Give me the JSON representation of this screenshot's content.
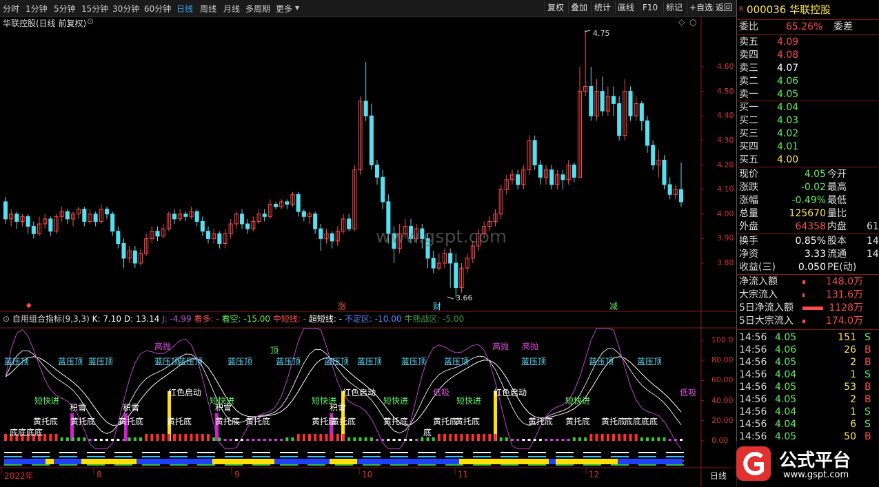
{
  "toolbar": {
    "periods": [
      "分时",
      "1分钟",
      "5分钟",
      "15分钟",
      "30分钟",
      "60分钟",
      "日线",
      "周线",
      "月线",
      "多周期",
      "更多"
    ],
    "active": "日线",
    "right_buttons": [
      "复权",
      "叠加",
      "统计",
      "画线",
      "F10",
      "标记",
      "+自选",
      "返回"
    ]
  },
  "chart": {
    "title": "华联控股(日线 前复权)",
    "price_ticks": [
      "4.60",
      "4.50",
      "4.40",
      "4.30",
      "4.20",
      "4.10",
      "4.00",
      "3.90",
      "3.80"
    ],
    "high_label": "4.75",
    "low_label": "3.66",
    "watermark": "www.gspt.com",
    "event_markers": [
      "涨",
      "财",
      "减"
    ],
    "indicator_header": {
      "name": "自用组合指标(9,3,3)",
      "k": "K: 7.10",
      "d": "D: 13.14",
      "j": "J: -4.99",
      "kanduo": "看多: -",
      "kankong": "看空: -15.00",
      "zhongduan": "中短线: -",
      "chaoduan": "超短线: -",
      "buding": "不定区: -10.00",
      "niuxiong": "牛熊战区: -5.00"
    },
    "ind_ticks": [
      "100.0",
      "80.00",
      "60.00",
      "40.00",
      "20.00",
      "0.00"
    ],
    "dates": [
      "2022年",
      "8",
      "9",
      "10",
      "11",
      "12"
    ],
    "period_label": "日线",
    "annotations": [
      {
        "t": "蓝压顶",
        "c": "cyan"
      },
      {
        "t": "蓝压顶",
        "c": "cyan"
      },
      {
        "t": "蓝压顶",
        "c": "cyan"
      },
      {
        "t": "蓝压顶",
        "c": "cyan"
      },
      {
        "t": "蓝压顶",
        "c": "cyan"
      },
      {
        "t": "蓝压顶",
        "c": "cyan"
      },
      {
        "t": "蓝压顶",
        "c": "cyan"
      },
      {
        "t": "蓝压顶",
        "c": "cyan"
      },
      {
        "t": "蓝压顶",
        "c": "cyan"
      },
      {
        "t": "蓝压顶",
        "c": "cyan"
      },
      {
        "t": "蓝压顶",
        "c": "cyan"
      },
      {
        "t": "蓝压顶",
        "c": "cyan"
      },
      {
        "t": "蓝压顶",
        "c": "cyan"
      },
      {
        "t": "蓝压顶",
        "c": "cyan"
      },
      {
        "t": "高抛",
        "c": "magenta"
      },
      {
        "t": "高抛",
        "c": "magenta"
      },
      {
        "t": "高抛",
        "c": "magenta"
      },
      {
        "t": "顶",
        "c": "green"
      },
      {
        "t": "短快进",
        "c": "green"
      },
      {
        "t": "短快进",
        "c": "green"
      },
      {
        "t": "短快进",
        "c": "green"
      },
      {
        "t": "短快进",
        "c": "green"
      },
      {
        "t": "短快进",
        "c": "green"
      },
      {
        "t": "短快进",
        "c": "green"
      },
      {
        "t": "积雪",
        "c": "white"
      },
      {
        "t": "积雪",
        "c": "white"
      },
      {
        "t": "积雪",
        "c": "white"
      },
      {
        "t": "积雪",
        "c": "white"
      },
      {
        "t": "红色启动",
        "c": "white"
      },
      {
        "t": "红色启动",
        "c": "white"
      },
      {
        "t": "红色启动",
        "c": "white"
      },
      {
        "t": "低吸",
        "c": "magenta"
      },
      {
        "t": "低吸",
        "c": "magenta"
      },
      {
        "t": "黄托底",
        "c": "white"
      },
      {
        "t": "黄托底",
        "c": "white"
      },
      {
        "t": "黄托底",
        "c": "white"
      },
      {
        "t": "黄托底",
        "c": "white"
      },
      {
        "t": "黄托底",
        "c": "white"
      },
      {
        "t": "黄托底",
        "c": "white"
      },
      {
        "t": "黄托底",
        "c": "white"
      },
      {
        "t": "黄托底",
        "c": "white"
      },
      {
        "t": "黄托底",
        "c": "white"
      },
      {
        "t": "黄托底",
        "c": "white"
      },
      {
        "t": "黄托底",
        "c": "white"
      },
      {
        "t": "黄托底",
        "c": "white"
      },
      {
        "t": "黄托底",
        "c": "white"
      },
      {
        "t": "黄托底",
        "c": "white"
      },
      {
        "t": "底底底底",
        "c": "white"
      },
      {
        "t": "底底底底",
        "c": "white"
      },
      {
        "t": "底",
        "c": "white"
      }
    ]
  },
  "panel": {
    "code": "000036",
    "name": "华联控股",
    "weibi_label": "委比",
    "weibi": "65.26%",
    "weicha_label": "委差",
    "asks": [
      {
        "label": "卖五",
        "price": "4.09",
        "color": "red"
      },
      {
        "label": "卖四",
        "price": "4.08",
        "color": "red"
      },
      {
        "label": "卖三",
        "price": "4.07",
        "color": "white"
      },
      {
        "label": "卖二",
        "price": "4.06",
        "color": "green"
      },
      {
        "label": "卖一",
        "price": "4.05",
        "color": "green"
      }
    ],
    "bids": [
      {
        "label": "买一",
        "price": "4.04",
        "color": "green"
      },
      {
        "label": "买二",
        "price": "4.03",
        "color": "green"
      },
      {
        "label": "买三",
        "price": "4.02",
        "color": "green"
      },
      {
        "label": "买四",
        "price": "4.01",
        "color": "green"
      },
      {
        "label": "买五",
        "price": "4.00",
        "color": "yellow"
      }
    ],
    "stats": [
      {
        "l": "现价",
        "v": "4.05",
        "vc": "green",
        "r": "今开"
      },
      {
        "l": "涨跌",
        "v": "-0.02",
        "vc": "green",
        "r": "最高"
      },
      {
        "l": "涨幅",
        "v": "-0.49%",
        "vc": "green",
        "r": "最低"
      },
      {
        "l": "总量",
        "v": "125670",
        "vc": "yellow",
        "r": "量比"
      },
      {
        "l": "外盘",
        "v": "64358",
        "vc": "red",
        "r": "内盘",
        "r2": "61"
      }
    ],
    "stats2": [
      {
        "l": "换手",
        "v": "0.85%",
        "r": "股本",
        "r2": "14"
      },
      {
        "l": "净资",
        "v": "3.33",
        "r": "流通",
        "r2": "14"
      },
      {
        "l": "收益(三)",
        "v": "0.050",
        "r": "PE(动)",
        "r2": ""
      }
    ],
    "flows": [
      {
        "l": "净流入额",
        "v": "148.0万",
        "bar": 4
      },
      {
        "l": "大宗流入",
        "v": "131.6万",
        "bar": 3
      },
      {
        "l": "5日净流入额",
        "v": "1128万",
        "bar": 30
      },
      {
        "l": "5日大宗流入",
        "v": "174.0万",
        "bar": 4
      }
    ],
    "ticks": [
      {
        "t": "14:56",
        "p": "4.05",
        "pc": "green",
        "v": "151",
        "s": "S"
      },
      {
        "t": "14:56",
        "p": "4.06",
        "pc": "green",
        "v": "26",
        "s": "B"
      },
      {
        "t": "14:56",
        "p": "4.05",
        "pc": "green",
        "v": "2",
        "s": "B"
      },
      {
        "t": "14:56",
        "p": "4.04",
        "pc": "green",
        "v": "1",
        "s": "S"
      },
      {
        "t": "14:56",
        "p": "4.05",
        "pc": "green",
        "v": "53",
        "s": "B"
      },
      {
        "t": "14:56",
        "p": "4.05",
        "pc": "green",
        "v": "2",
        "s": "B"
      },
      {
        "t": "14:56",
        "p": "4.04",
        "pc": "green",
        "v": "1",
        "s": "S"
      },
      {
        "t": "14:56",
        "p": "4.04",
        "pc": "green",
        "v": "6",
        "s": "S"
      },
      {
        "t": "14:56",
        "p": "4.05",
        "pc": "green",
        "v": "50",
        "s": "B"
      }
    ],
    "logo_text": "公式平台",
    "logo_url": "www.gspt.com"
  },
  "colors": {
    "up": "#ff4b4b",
    "down": "#54e0f0",
    "grid": "#8a1a1a",
    "bg": "#000000"
  }
}
